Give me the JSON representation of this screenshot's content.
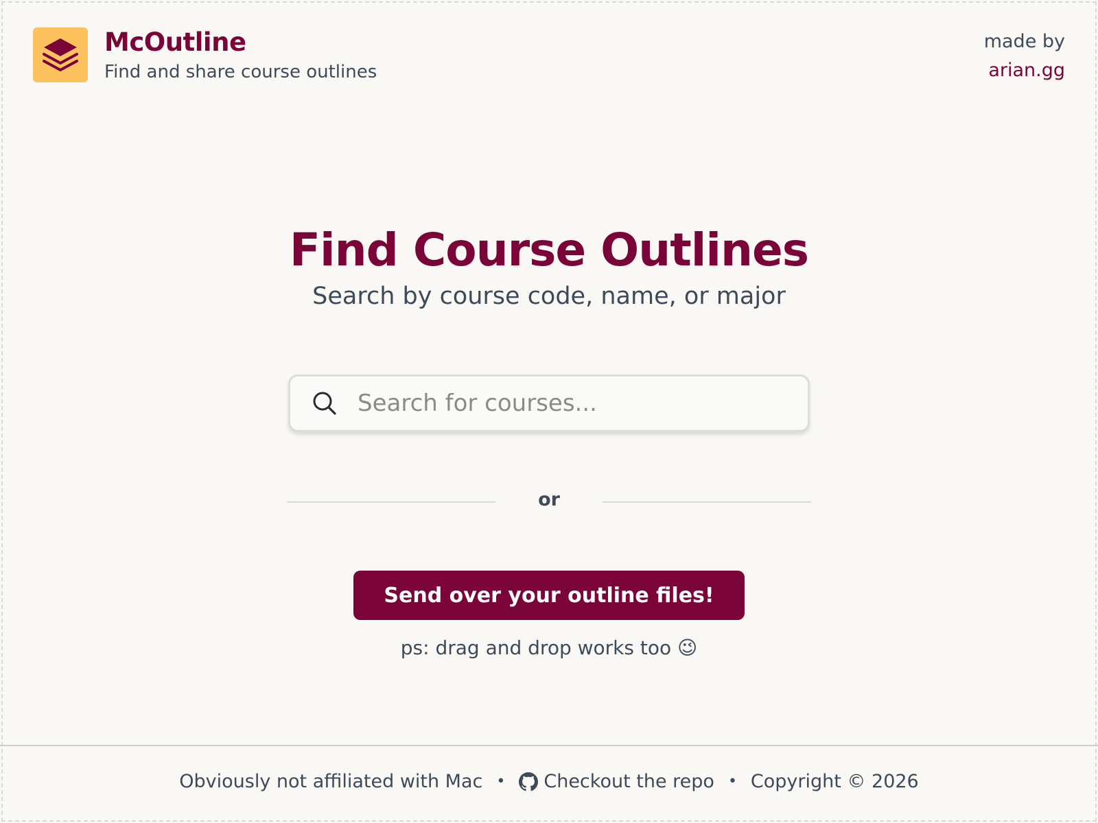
{
  "header": {
    "brand_title": "McOutline",
    "brand_subtitle": "Find and share course outlines",
    "logo_icon": "stacked-layers-icon"
  },
  "made_by": {
    "label": "made by",
    "link": "arian.gg"
  },
  "hero": {
    "title": "Find Course Outlines",
    "subtitle": "Search by course code, name, or major"
  },
  "search": {
    "placeholder": "Search for courses...",
    "value": "",
    "icon": "search-icon"
  },
  "divider": {
    "text": "or"
  },
  "upload": {
    "button_label": "Send over your outline files!",
    "hint": "ps: drag and drop works too 😉"
  },
  "footer": {
    "disclaimer": "Obviously not affiliated with Mac",
    "repo_link": "Checkout the repo",
    "copyright": "Copyright © 2026",
    "separator": "•"
  },
  "colors": {
    "brand": "#7a0338",
    "logo_bg": "#fcc25e",
    "text": "#3d4a59",
    "background": "#f9f8f5"
  }
}
